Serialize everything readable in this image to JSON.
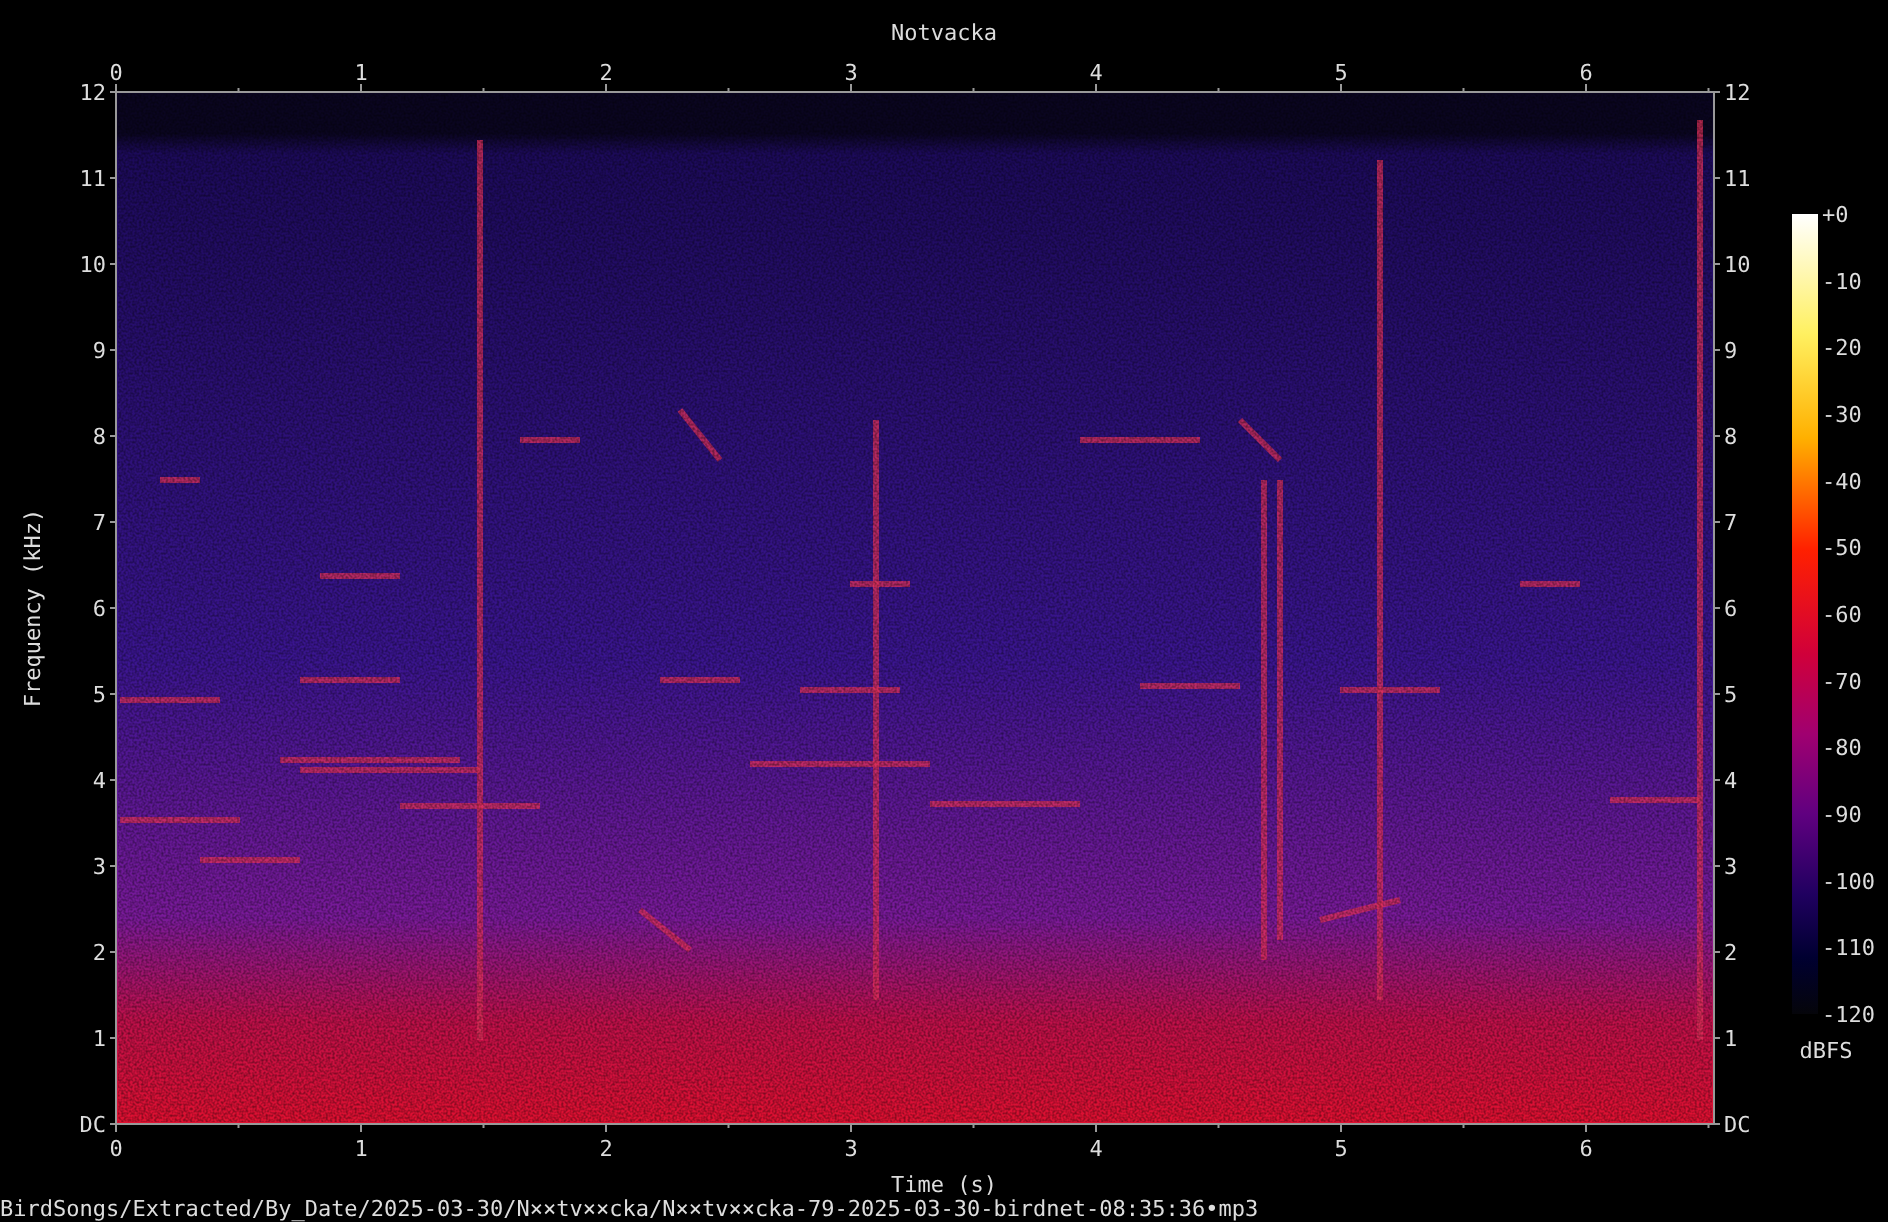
{
  "title": "Notvacka",
  "x_axis": {
    "label": "Time (s)",
    "top_ticks": [
      "0",
      "1",
      "2",
      "3",
      "4",
      "5",
      "6"
    ],
    "bottom_ticks": [
      "0",
      "1",
      "2",
      "3",
      "4",
      "5",
      "6"
    ]
  },
  "y_axis": {
    "label": "Frequency (kHz)",
    "left_ticks": [
      "12",
      "11",
      "10",
      "9",
      "8",
      "7",
      "6",
      "5",
      "4",
      "3",
      "2",
      "1",
      "DC"
    ],
    "right_ticks": [
      "12",
      "11",
      "10",
      "9",
      "8",
      "7",
      "6",
      "5",
      "4",
      "3",
      "2",
      "1",
      "DC"
    ]
  },
  "colorbar": {
    "unit": "dBFS",
    "ticks": [
      "+0",
      "-10",
      "-20",
      "-30",
      "-40",
      "-50",
      "-60",
      "-70",
      "-80",
      "-90",
      "-100",
      "-110",
      "-120"
    ]
  },
  "file_path": "BirdSongs/Extracted/By_Date/2025-03-30/N××tv××cka/N××tv××cka-79-2025-03-30-birdnet-08:35:36•mp3"
}
